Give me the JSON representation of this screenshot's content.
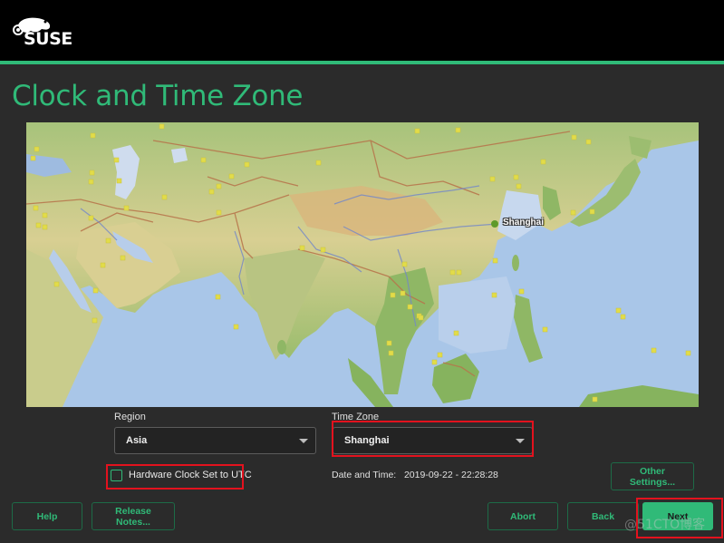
{
  "brand": {
    "name": "SUSE",
    "accent": "#30ba78"
  },
  "page": {
    "title": "Clock and Time Zone"
  },
  "map": {
    "highlighted_city": "Shanghai",
    "land_color": "#9fc27a",
    "ocean_color": "#a9c6e8",
    "city_marker_color": "#e2dc4a"
  },
  "region": {
    "label": "Region",
    "value": "Asia"
  },
  "timezone": {
    "label": "Time Zone",
    "value": "Shanghai"
  },
  "hardware_clock": {
    "label": "Hardware Clock Set to UTC",
    "checked": false
  },
  "datetime": {
    "label": "Date and Time:",
    "value": "2019-09-22 - 22:28:28"
  },
  "buttons": {
    "other_settings": "Other Settings...",
    "help": "Help",
    "release_notes": "Release Notes...",
    "abort": "Abort",
    "back": "Back",
    "next": "Next"
  },
  "watermark": "@51CTO博客"
}
